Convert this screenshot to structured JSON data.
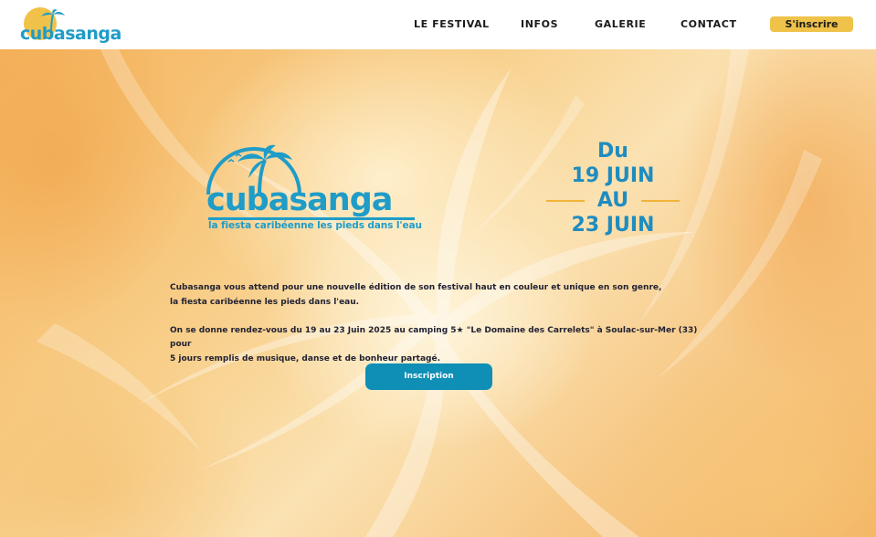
{
  "header": {
    "logo_text": "cubasanga",
    "nav": [
      {
        "label": "LE FESTIVAL"
      },
      {
        "label": "INFOS"
      },
      {
        "label": "GALERIE"
      },
      {
        "label": "CONTACT"
      }
    ],
    "signup_label": "S'inscrire"
  },
  "hero": {
    "logo_text": "cubasanga",
    "tagline": "la fiesta caribéenne les pieds dans l'eau",
    "dates": {
      "du": "Du",
      "start": "19 JUIN",
      "au": "AU",
      "end": "23 JUIN"
    },
    "paragraphs": [
      "Cubasanga vous attend pour une nouvelle édition de son festival haut en couleur et unique en son genre,\nla fiesta caribéenne les pieds dans l'eau.",
      "On se donne rendez-vous du 19 au 23 Juin 2025 au camping 5★ \"Le Domaine des Carrelets\" à Soulac-sur-Mer (33) pour\n5 jours remplis de musique, danse et de bonheur partagé."
    ],
    "cta_label": "Inscription"
  },
  "colors": {
    "brand_blue": "#1f9cc7",
    "button_blue": "#0f8fb6",
    "accent_yellow": "#efc24a"
  }
}
